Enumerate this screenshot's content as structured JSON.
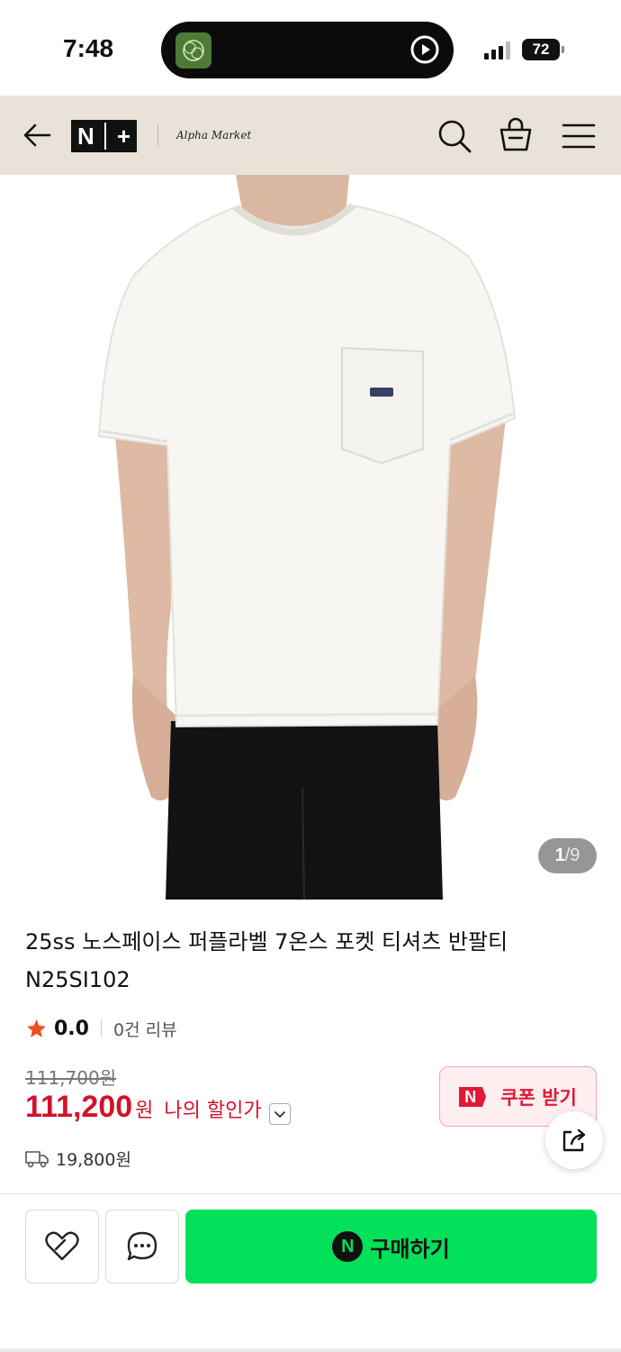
{
  "status_bar": {
    "time": "7:48",
    "battery": "72"
  },
  "header": {
    "logo_left": "N",
    "logo_right": "+",
    "store_name": "Alpha Market",
    "icons": [
      "back-arrow-icon",
      "search-icon",
      "shopping-bag-icon",
      "hamburger-menu-icon"
    ]
  },
  "gallery": {
    "current": "1",
    "separator": "/",
    "total": "9"
  },
  "product": {
    "title": "25ss 노스페이스 퍼플라벨 7온스 포켓 티셔츠 반팔티 N25SI102",
    "rating": "0.0",
    "review_count": "0건 리뷰",
    "original_price": "111,700원",
    "sale_price": "111,200",
    "sale_unit": "원",
    "my_discount_label": "나의 할인가",
    "shipping_fee": "19,800원"
  },
  "coupon": {
    "logo": "N",
    "label": "쿠폰 받기"
  },
  "bottom_bar": {
    "npay_logo": "N",
    "buy_label": "구매하기"
  },
  "colors": {
    "header_bg": "#e9e2d9",
    "price_red": "#d3112a",
    "buy_green": "#03e05a",
    "star": "#f04e23"
  }
}
